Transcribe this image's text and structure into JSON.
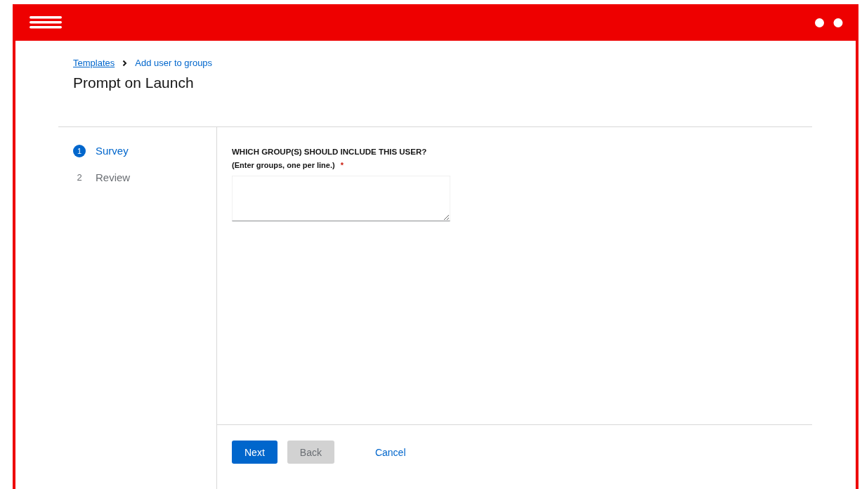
{
  "breadcrumb": [
    {
      "label": "Templates",
      "kind": "link"
    },
    {
      "label": "Add user to groups",
      "kind": "current"
    }
  ],
  "title": "Prompt on Launch",
  "steps": [
    {
      "number": "1",
      "label": "Survey",
      "selected": true
    },
    {
      "number": "2",
      "label": "Review",
      "selected": false
    }
  ],
  "question": {
    "label": "WHICH GROUP(S) SHOULD INCLUDE THIS USER?",
    "hint": "(Enter groups, one per line.)",
    "required_mark": "*"
  },
  "buttons": [
    {
      "label": "Next",
      "kind": "primary",
      "disabled": false
    },
    {
      "label": "Back",
      "kind": "secondary",
      "disabled": true
    },
    {
      "label": "Cancel",
      "kind": "link",
      "disabled": false
    }
  ]
}
